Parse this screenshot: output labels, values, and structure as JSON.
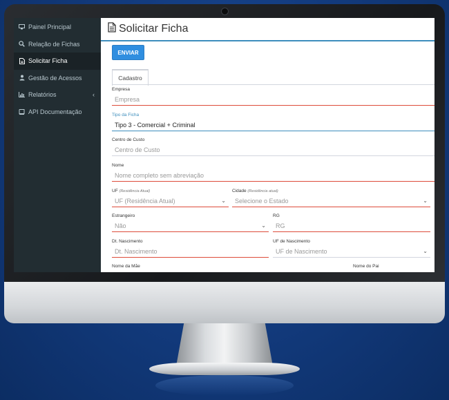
{
  "sidebar": {
    "items": [
      {
        "icon": "monitor-icon",
        "label": "Painel Principal"
      },
      {
        "icon": "search-icon",
        "label": "Relação de Fichas"
      },
      {
        "icon": "file-icon",
        "label": "Solicitar Ficha"
      },
      {
        "icon": "user-icon",
        "label": "Gestão de Acessos"
      },
      {
        "icon": "bar-chart-icon",
        "label": "Relatórios"
      },
      {
        "icon": "book-icon",
        "label": "API Documentação"
      }
    ]
  },
  "page": {
    "title": "Solicitar Ficha",
    "title_icon": "document-icon"
  },
  "actions": {
    "submit_label": "ENVIAR"
  },
  "tabs": [
    {
      "label": "Cadastro"
    }
  ],
  "form": {
    "empresa": {
      "label": "Empresa",
      "placeholder": "Empresa"
    },
    "tipo_ficha": {
      "label": "Tipo da Ficha",
      "value": "Tipo 3 - Comercial + Criminal"
    },
    "centro_custo": {
      "label": "Centro de Custo",
      "placeholder": "Centro de Custo"
    },
    "nome": {
      "label": "Nome",
      "placeholder": "Nome completo sem abreviação"
    },
    "uf": {
      "label": "UF",
      "label_note": "(Residência Atual)",
      "value": "UF (Residência Atual)"
    },
    "cidade": {
      "label": "Cidade",
      "label_note": "(Residência atual)",
      "value": "Selecione o Estado"
    },
    "estrangeiro": {
      "label": "Estrangeiro",
      "value": "Não"
    },
    "rg": {
      "label": "RG",
      "placeholder": "RG"
    },
    "dt_nascimento": {
      "label": "Dt. Nascimento",
      "placeholder": "Dt. Nascimento"
    },
    "uf_nascimento": {
      "label": "UF de Nascimento",
      "value": "UF de Nascimento"
    },
    "nome_mae": {
      "label": "Nome da Mãe"
    },
    "nome_pai": {
      "label": "Nome do Pai"
    }
  },
  "colors": {
    "accent": "#3c8dbc",
    "button": "#2f8ee0",
    "error_underline": "#dd4b39",
    "sidebar_bg": "#222d32"
  }
}
